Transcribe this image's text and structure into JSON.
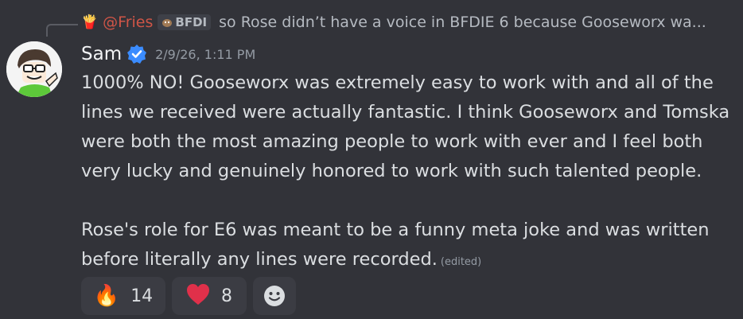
{
  "reply": {
    "author": "@Fries",
    "author_icon": "fries-icon",
    "tag_label": "BFDI",
    "snippet": "so Rose didn’t have a voice in BFDIE 6 because Gooseworx wa..."
  },
  "message": {
    "username": "Sam",
    "verified": true,
    "timestamp": "2/9/26, 1:11 PM",
    "paragraph1": "1000% NO! Gooseworx was extremely easy to work with and all of the lines we received were actually fantastic. I think Gooseworx and Tomska were both the most amazing people to work with ever and I feel both very lucky and genuinely honored to work with such talented people.",
    "paragraph2": "Rose's role for E6 was meant to be a funny meta joke and was written before literally any lines were recorded.",
    "edited_label": "(edited)"
  },
  "reactions": [
    {
      "emoji": "🔥",
      "count": "14",
      "icon": "fire-icon"
    },
    {
      "emoji": "❤",
      "count": "8",
      "icon": "heart-icon"
    }
  ],
  "colors": {
    "background": "#323339",
    "verified_badge": "#3b8cff",
    "mention": "#eb5b4a",
    "heart": "#e0304a"
  }
}
